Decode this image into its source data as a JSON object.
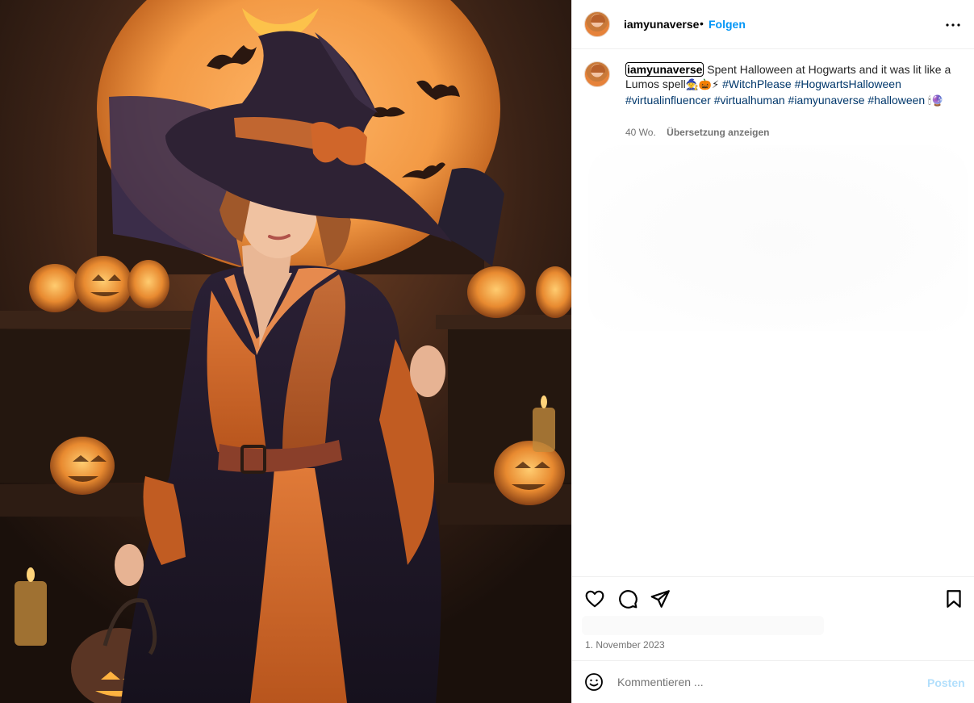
{
  "post": {
    "username": "iamyunaverse",
    "dot": "•",
    "follow_label": "Folgen",
    "more_icon": "more-horizontal-icon"
  },
  "caption": {
    "username": "iamyunaverse",
    "text": "Spent Halloween at Hogwarts and it was lit like a Lumos spell",
    "emojis": "🧙🎃⚡",
    "hashtags_line1": "#WitchPlease #HogwartsHalloween",
    "hashtags_line2": "#virtualinfluencer #virtualhuman #iamyunaverse #halloween",
    "end_emojis": "🕯🔮",
    "time": "40 Wo.",
    "translate_label": "Übersetzung anzeigen"
  },
  "actions": {
    "like_icon": "heart-icon",
    "comment_icon": "comment-icon",
    "share_icon": "send-icon",
    "save_icon": "bookmark-icon"
  },
  "date": "1. November 2023",
  "composer": {
    "placeholder": "Kommentieren ...",
    "post_label": "Posten",
    "emoji_icon": "emoji-icon"
  },
  "colors": {
    "link": "#0095f6",
    "hashtag": "#00376b",
    "muted": "#737373",
    "post_disabled": "#b2dffc"
  }
}
